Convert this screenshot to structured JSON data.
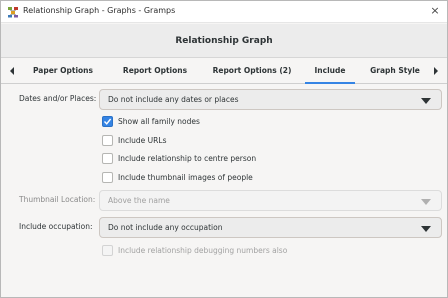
{
  "window": {
    "title": "Relationship Graph - Graphs - Gramps",
    "close_glyph": "×"
  },
  "header": {
    "title": "Relationship Graph"
  },
  "tabs": [
    {
      "label": "Paper Options",
      "active": false
    },
    {
      "label": "Report Options",
      "active": false
    },
    {
      "label": "Report Options (2)",
      "active": false
    },
    {
      "label": "Include",
      "active": true
    },
    {
      "label": "Graph Style",
      "active": false
    }
  ],
  "form": {
    "dates_places": {
      "label": "Dates and/or Places:",
      "value": "Do not include any dates or places"
    },
    "checkboxes": [
      {
        "label": "Show all family nodes",
        "checked": true,
        "enabled": true
      },
      {
        "label": "Include URLs",
        "checked": false,
        "enabled": true
      },
      {
        "label": "Include relationship to centre person",
        "checked": false,
        "enabled": true
      },
      {
        "label": "Include thumbnail images of people",
        "checked": false,
        "enabled": true
      }
    ],
    "thumbnail_location": {
      "label": "Thumbnail Location:",
      "value": "Above the name",
      "enabled": false
    },
    "occupation": {
      "label": "Include occupation:",
      "value": "Do not include any occupation"
    },
    "debug_checkbox": {
      "label": "Include relationship debugging numbers also",
      "checked": false,
      "enabled": false
    }
  },
  "colors": {
    "accent": "#3584e4",
    "window_bg": "#f6f5f4",
    "text": "#2e3436",
    "disabled_text": "#a0a0a0"
  }
}
